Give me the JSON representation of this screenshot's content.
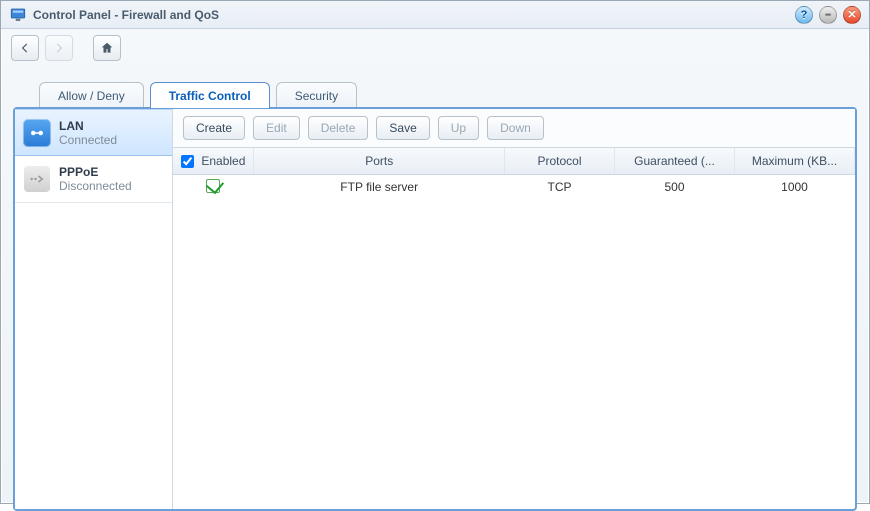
{
  "window": {
    "title": "Control Panel - Firewall and QoS"
  },
  "tabs": {
    "allow_deny": "Allow / Deny",
    "traffic_control": "Traffic Control",
    "security": "Security"
  },
  "sidebar": {
    "items": [
      {
        "title": "LAN",
        "sub": "Connected"
      },
      {
        "title": "PPPoE",
        "sub": "Disconnected"
      }
    ]
  },
  "toolbar": {
    "create": "Create",
    "edit": "Edit",
    "delete": "Delete",
    "save": "Save",
    "up": "Up",
    "down": "Down"
  },
  "columns": {
    "enabled": "Enabled",
    "ports": "Ports",
    "protocol": "Protocol",
    "guaranteed": "Guaranteed (...",
    "maximum": "Maximum (KB..."
  },
  "rows": [
    {
      "enabled": true,
      "ports": "FTP file server",
      "protocol": "TCP",
      "guaranteed": "500",
      "maximum": "1000"
    }
  ]
}
